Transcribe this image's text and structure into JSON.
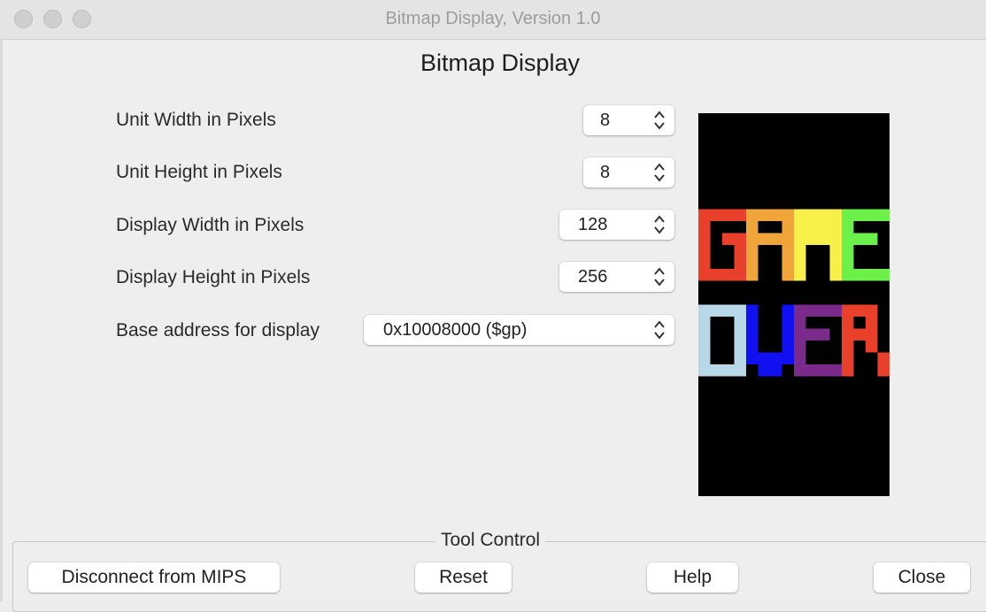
{
  "window": {
    "title": "Bitmap Display, Version 1.0"
  },
  "header": {
    "title": "Bitmap Display"
  },
  "settings": {
    "unit_width": {
      "label": "Unit Width in Pixels",
      "value": "8"
    },
    "unit_height": {
      "label": "Unit Height in Pixels",
      "value": "8"
    },
    "display_width": {
      "label": "Display Width in Pixels",
      "value": "128"
    },
    "display_height": {
      "label": "Display Height in Pixels",
      "value": "256"
    },
    "base_address": {
      "label": "Base address for display",
      "value": "0x10008000 ($gp)"
    }
  },
  "display": {
    "background": "#000000",
    "text_rows": [
      "GAME",
      "OVER"
    ],
    "letter_colors": {
      "G": "#e8402a",
      "A1": "#f0a53a",
      "M": "#f7f04a",
      "E1": "#6cf04a",
      "O": "#b8d8e8",
      "V": "#1010f0",
      "E2": "#7a2a8a",
      "R": "#e8402a"
    }
  },
  "tool_control": {
    "legend": "Tool Control",
    "buttons": {
      "disconnect": "Disconnect from MIPS",
      "reset": "Reset",
      "help": "Help",
      "close": "Close"
    }
  }
}
